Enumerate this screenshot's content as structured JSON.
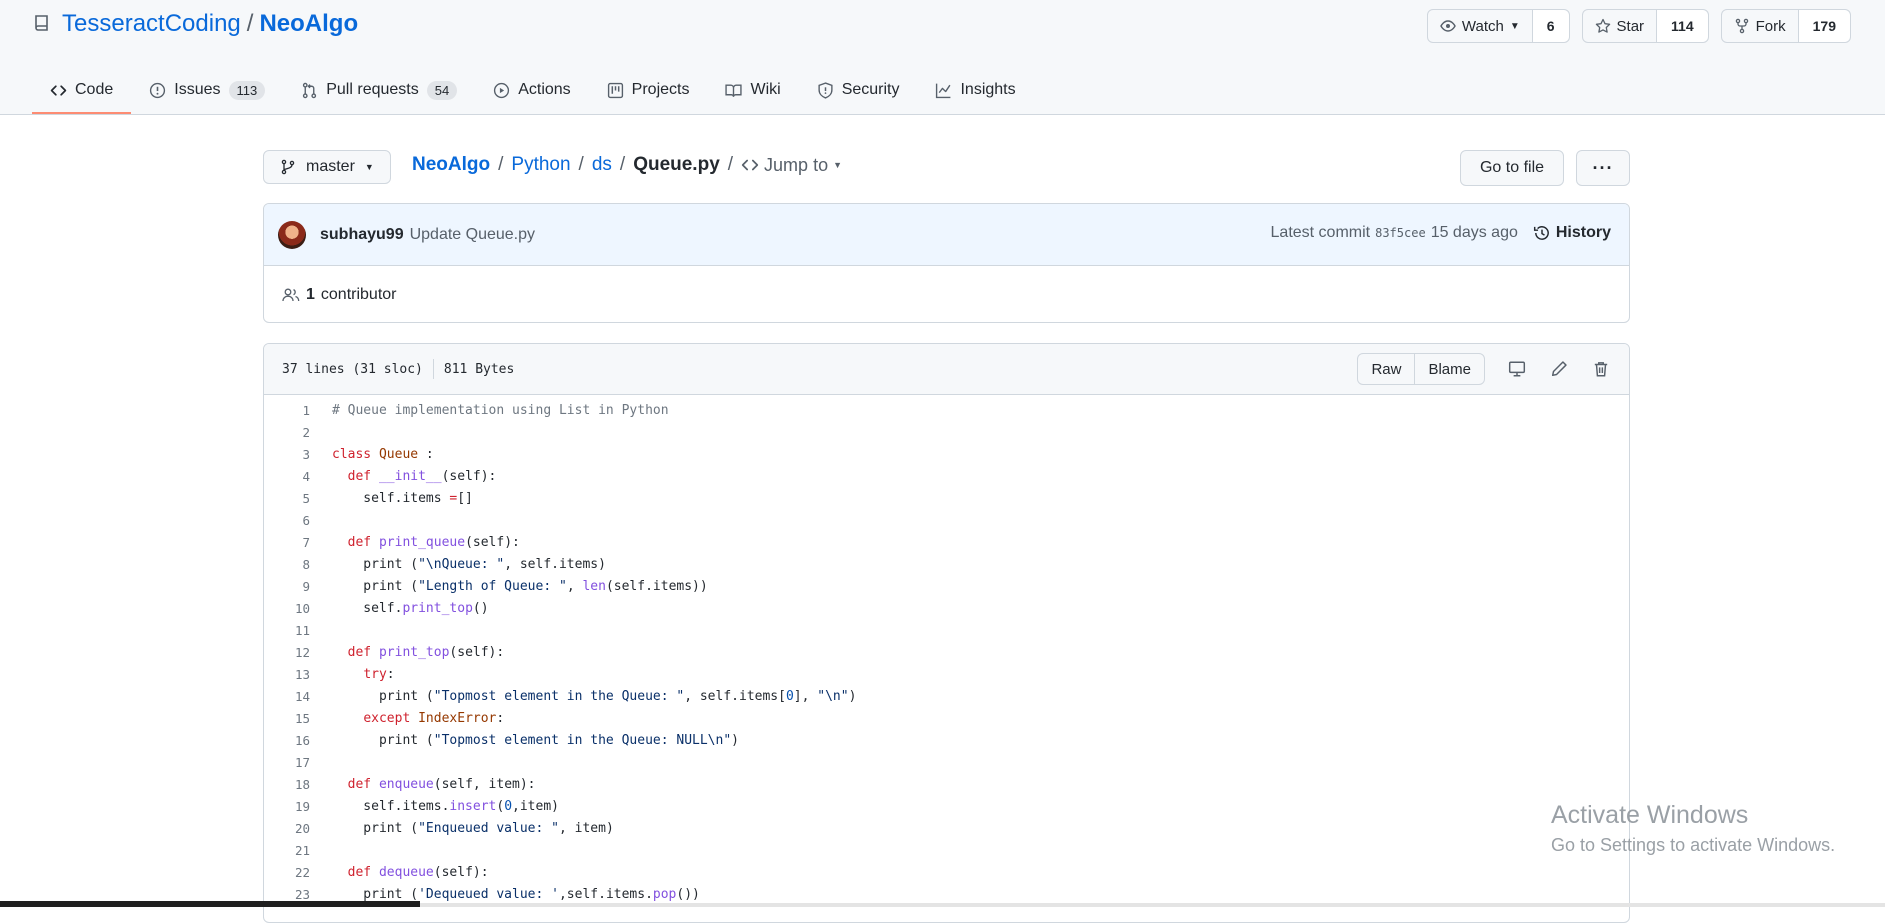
{
  "repo": {
    "owner": "TesseractCoding",
    "separator": "/",
    "name": "NeoAlgo"
  },
  "actions": {
    "watch": {
      "label": "Watch",
      "count": "6"
    },
    "star": {
      "label": "Star",
      "count": "114"
    },
    "fork": {
      "label": "Fork",
      "count": "179"
    }
  },
  "tabs": [
    {
      "label": "Code",
      "count": ""
    },
    {
      "label": "Issues",
      "count": "113"
    },
    {
      "label": "Pull requests",
      "count": "54"
    },
    {
      "label": "Actions",
      "count": ""
    },
    {
      "label": "Projects",
      "count": ""
    },
    {
      "label": "Wiki",
      "count": ""
    },
    {
      "label": "Security",
      "count": ""
    },
    {
      "label": "Insights",
      "count": ""
    }
  ],
  "branch": "master",
  "breadcrumb": {
    "root": "NeoAlgo",
    "dir1": "Python",
    "dir2": "ds",
    "file": "Queue.py",
    "sep": "/",
    "jump": "Jump to"
  },
  "go_to_file": "Go to file",
  "more_label": "···",
  "commit": {
    "author": "subhayu99",
    "message": "Update Queue.py",
    "latest_label": "Latest commit",
    "sha": "83f5cee",
    "age": "15 days ago",
    "history_label": "History"
  },
  "contributors": {
    "count": "1",
    "label": "contributor"
  },
  "file_info": {
    "lines": "37 lines (31 sloc)",
    "size": "811 Bytes"
  },
  "file_buttons": {
    "raw": "Raw",
    "blame": "Blame"
  },
  "code_lines": [
    "# Queue implementation using List in Python",
    "",
    "class Queue :",
    "  def __init__(self):",
    "    self.items =[]",
    "",
    "  def print_queue(self):",
    "    print (\"\\nQueue: \", self.items)",
    "    print (\"Length of Queue: \", len(self.items))",
    "    self.print_top()",
    "",
    "  def print_top(self):",
    "    try:",
    "      print (\"Topmost element in the Queue: \", self.items[0], \"\\n\")",
    "    except IndexError:",
    "      print (\"Topmost element in the Queue: NULL\\n\")",
    "",
    "  def enqueue(self, item):",
    "    self.items.insert(0,item)",
    "    print (\"Enqueued value: \", item)",
    "",
    "  def dequeue(self):",
    "    print ('Dequeued value: ',self.items.pop())"
  ],
  "watermark": {
    "line1": "Activate Windows",
    "line2": "Go to Settings to activate Windows."
  }
}
